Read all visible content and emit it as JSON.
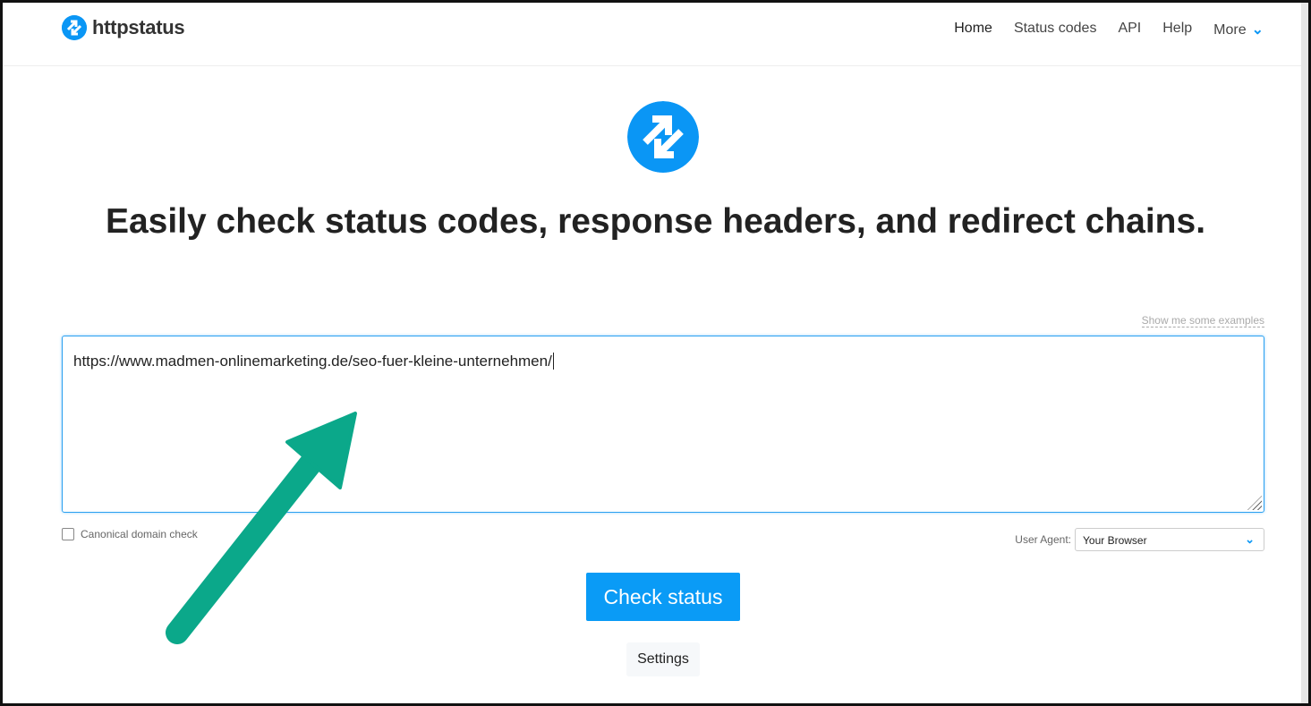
{
  "nav": {
    "brand": "httpstatus",
    "items": [
      "Home",
      "Status codes",
      "API",
      "Help",
      "More"
    ]
  },
  "hero": {
    "pre": "Easily check ",
    "b1": "status codes",
    "mid1": ", ",
    "b2": "response headers",
    "mid2": ", and ",
    "b3": "redirect chains",
    "end": "."
  },
  "form": {
    "examples_link": "Show me some examples",
    "url_value": "https://www.madmen-onlinemarketing.de/seo-fuer-kleine-unternehmen/",
    "canonical_label": "Canonical domain check",
    "user_agent_label": "User Agent:",
    "user_agent_value": "Your Browser",
    "check_button": "Check status",
    "settings_button": "Settings"
  },
  "colors": {
    "brand": "#0a96f5",
    "annotation_arrow": "#0ba88a"
  }
}
